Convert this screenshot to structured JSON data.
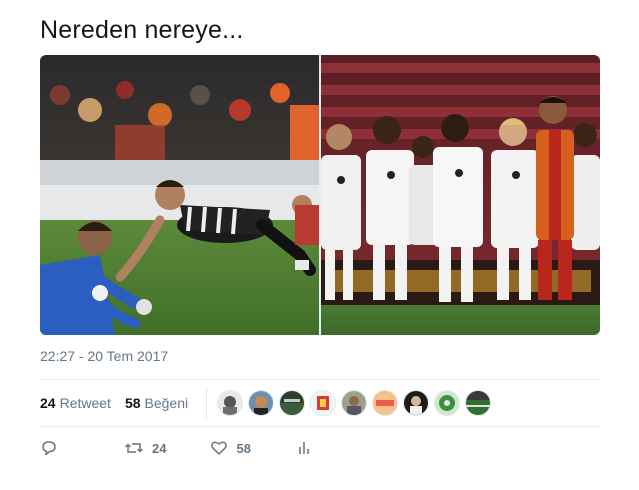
{
  "tweet": {
    "text": "Nereden nereye...",
    "timestamp": "22:27 - 20 Tem 2017"
  },
  "media": {
    "left_photo": "football-dive-photo",
    "right_photo": "team-celebration-photo"
  },
  "stats": {
    "retweet_count": "24",
    "retweet_label": "Retweet",
    "like_count": "58",
    "like_label": "Beğeni"
  },
  "liker_avatars": [
    {
      "icon": "avatar-1",
      "color": "#6d6d6d"
    },
    {
      "icon": "avatar-2",
      "color": "#c48a5a"
    },
    {
      "icon": "avatar-3",
      "color": "#3d5a3a"
    },
    {
      "icon": "avatar-4",
      "color": "#d83a3a"
    },
    {
      "icon": "avatar-5",
      "color": "#8a8f7a"
    },
    {
      "icon": "avatar-6",
      "color": "#f2c28a"
    },
    {
      "icon": "avatar-7",
      "color": "#1c1c1c"
    },
    {
      "icon": "avatar-8",
      "color": "#3f8f3f"
    },
    {
      "icon": "avatar-9",
      "color": "#2f6f2f"
    }
  ],
  "actions": {
    "reply_icon": "reply-icon",
    "retweet_icon": "retweet-icon",
    "retweet_count": "24",
    "like_icon": "heart-icon",
    "like_count": "58",
    "analytics_icon": "analytics-icon"
  },
  "colors": {
    "text": "#14171a",
    "secondary": "#657786",
    "divider": "#e6ecf0"
  }
}
